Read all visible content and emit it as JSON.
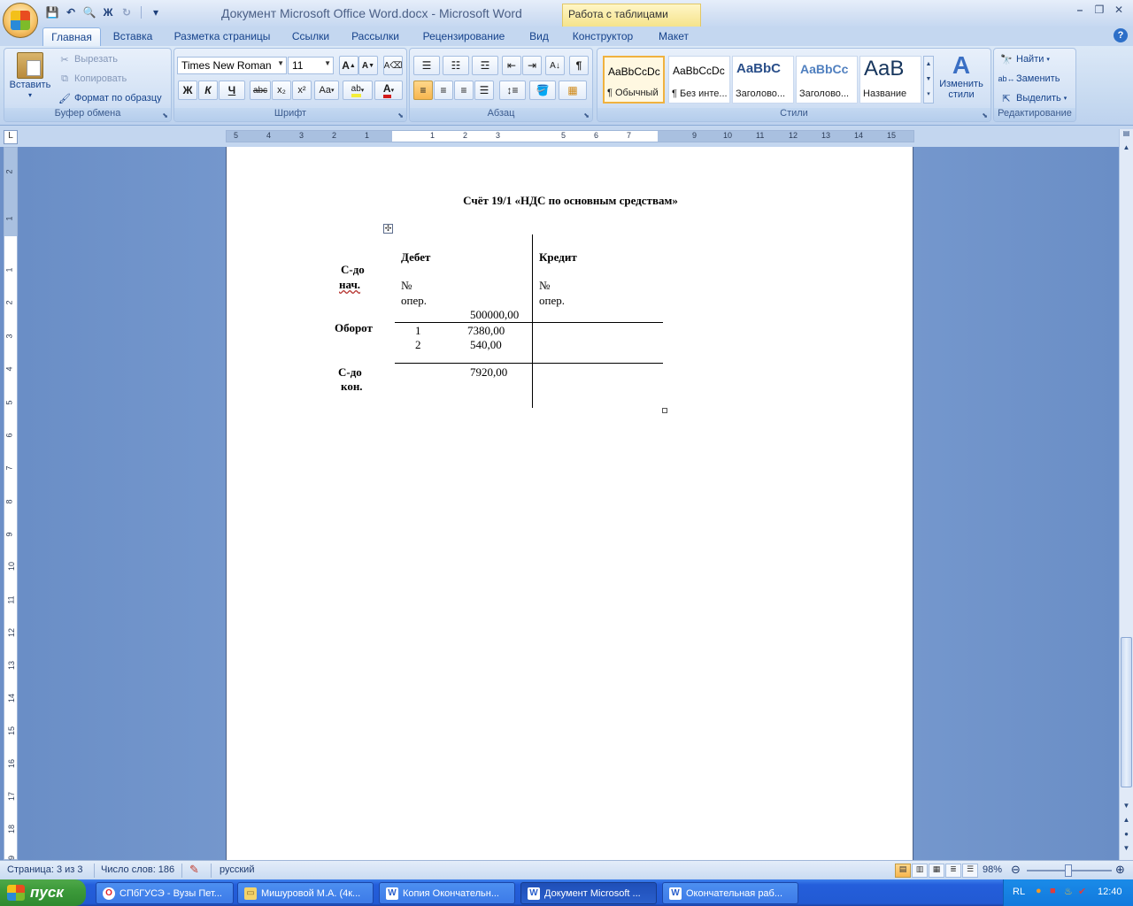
{
  "window": {
    "title": "Документ Microsoft Office Word.docx - Microsoft Word",
    "context_tools": "Работа с таблицами",
    "controls": {
      "minimize": "–",
      "restore": "❐",
      "close": "✕"
    }
  },
  "qat": {
    "save": "💾",
    "undo": "↶",
    "format": "Ж",
    "redo": "↻",
    "customize": "▾"
  },
  "tabs": [
    "Главная",
    "Вставка",
    "Разметка страницы",
    "Ссылки",
    "Рассылки",
    "Рецензирование",
    "Вид",
    "Конструктор",
    "Макет"
  ],
  "ribbon": {
    "clipboard": {
      "label": "Буфер обмена",
      "paste": "Вставить",
      "cut": "Вырезать",
      "copy": "Копировать",
      "format_painter": "Формат по образцу"
    },
    "font": {
      "label": "Шрифт",
      "font_name": "Times New Roman",
      "font_size": "11",
      "grow": "A",
      "shrink": "A",
      "bold": "Ж",
      "italic": "К",
      "underline": "Ч",
      "strike": "abc",
      "subscript": "x₂",
      "superscript": "x²",
      "case": "Aa",
      "highlight": "ab",
      "font_color": "A"
    },
    "paragraph": {
      "label": "Абзац",
      "pilcrow": "¶"
    },
    "styles": {
      "label": "Стили",
      "tiles": [
        {
          "sample": "AaBbCcDc",
          "name": "¶ Обычный"
        },
        {
          "sample": "AaBbCcDc",
          "name": "¶ Без инте..."
        },
        {
          "sample": "AaBbC",
          "name": "Заголово..."
        },
        {
          "sample": "AaBbCc",
          "name": "Заголово..."
        },
        {
          "sample": "AaB",
          "name": "Название"
        }
      ],
      "change_styles": "Изменить стили"
    },
    "editing": {
      "label": "Редактирование",
      "find": "Найти",
      "replace": "Заменить",
      "select": "Выделить"
    }
  },
  "ruler": {
    "h_numbers": [
      "5",
      "4",
      "3",
      "2",
      "1",
      "1",
      "2",
      "3",
      "5",
      "6",
      "7",
      "9",
      "10",
      "11",
      "12",
      "13",
      "14",
      "15"
    ],
    "v_numbers": [
      "2",
      "1",
      "1",
      "2",
      "3",
      "4",
      "5",
      "6",
      "7",
      "8",
      "9",
      "10",
      "11",
      "12",
      "13",
      "14",
      "15",
      "16",
      "17",
      "18",
      "19"
    ]
  },
  "document": {
    "title": "Счёт 19/1 «НДС по основным средствам»",
    "debit": "Дебет",
    "credit": "Кредит",
    "row_start": [
      "С-до",
      "нач."
    ],
    "row_turnover": "Оборот",
    "row_end": [
      "С-до",
      "кон."
    ],
    "op_no": "№",
    "op_label": "опер.",
    "opening_balance": "500000,00",
    "ops": [
      {
        "n": "1",
        "amount": "7380,00"
      },
      {
        "n": "2",
        "amount": "540,00"
      }
    ],
    "closing_balance": "7920,00"
  },
  "status": {
    "page": "Страница: 3 из 3",
    "words": "Число слов: 186",
    "language": "русский",
    "zoom": "98%"
  },
  "taskbar": {
    "start": "пуск",
    "tasks": [
      "СПбГУСЭ - Вузы Пет...",
      "Мишуровой М.А. (4к...",
      "Копия Окончательн...",
      "Документ Microsoft ...",
      "Окончательная раб..."
    ],
    "lang": "RL",
    "clock": "12:40"
  }
}
